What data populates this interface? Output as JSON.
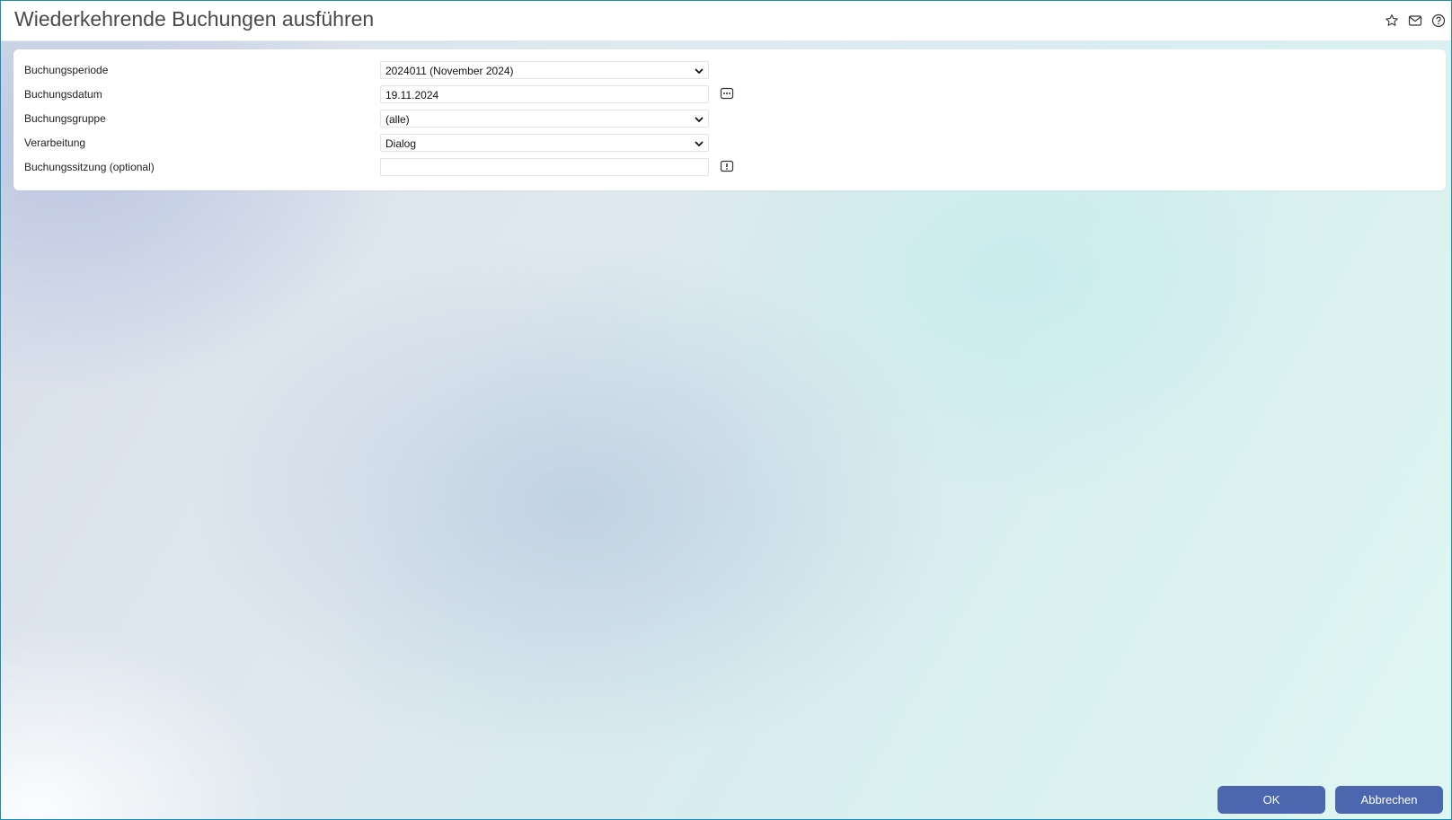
{
  "window": {
    "title": "Wiederkehrende Buchungen ausführen",
    "icons": [
      "star-icon",
      "mail-icon",
      "help-icon"
    ]
  },
  "form": {
    "fields": [
      {
        "label": "Buchungsperiode",
        "type": "select",
        "value": "2024011 (November 2024)"
      },
      {
        "label": "Buchungsdatum",
        "type": "date",
        "value": "19.11.2024",
        "side_icon": "date-picker-icon"
      },
      {
        "label": "Buchungsgruppe",
        "type": "select",
        "value": "(alle)"
      },
      {
        "label": "Verarbeitung",
        "type": "select",
        "value": "Dialog"
      },
      {
        "label": "Buchungssitzung (optional)",
        "type": "text",
        "value": "",
        "side_icon": "alert-icon"
      }
    ]
  },
  "footer": {
    "ok_label": "OK",
    "cancel_label": "Abbrechen"
  },
  "colors": {
    "accent": "#4d66b0",
    "border": "#1a8fb3"
  }
}
